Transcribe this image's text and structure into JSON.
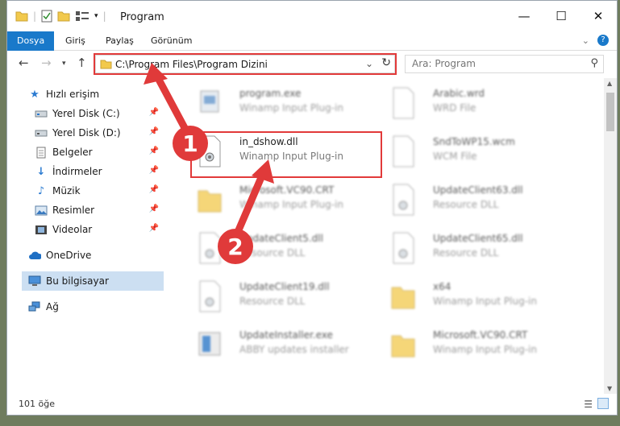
{
  "window": {
    "title": "Program"
  },
  "ribbon": {
    "tabs": [
      {
        "label": "Dosya",
        "active": true
      },
      {
        "label": "Giriş"
      },
      {
        "label": "Paylaş"
      },
      {
        "label": "Görünüm"
      }
    ]
  },
  "address": {
    "path": "C:\\Program Files\\Program Dizini"
  },
  "search": {
    "placeholder": "Ara: Program"
  },
  "sidebar": {
    "items": [
      {
        "label": "Hızlı erişim",
        "icon": "star-icon"
      },
      {
        "label": "Yerel Disk (C:)",
        "icon": "drive-icon"
      },
      {
        "label": "Yerel Disk (D:)",
        "icon": "drive-icon"
      },
      {
        "label": "Belgeler",
        "icon": "document-icon"
      },
      {
        "label": "İndirmeler",
        "icon": "download-icon"
      },
      {
        "label": "Müzik",
        "icon": "music-icon"
      },
      {
        "label": "Resimler",
        "icon": "pictures-icon"
      },
      {
        "label": "Videolar",
        "icon": "video-icon"
      },
      {
        "label": "OneDrive",
        "icon": "cloud-icon"
      },
      {
        "label": "Bu bilgisayar",
        "icon": "computer-icon"
      },
      {
        "label": "Ağ",
        "icon": "network-icon"
      }
    ]
  },
  "files": [
    {
      "name": "program.exe",
      "desc": "Winamp Input Plug-in"
    },
    {
      "name": "Arabic.wrd",
      "desc": "WRD File"
    },
    {
      "name": "in_dshow.dll",
      "desc": "Winamp Input Plug-in"
    },
    {
      "name": "SndToWP15.wcm",
      "desc": "WCM File"
    },
    {
      "name": "Microsoft.VC90.CRT",
      "desc": "Winamp Input Plug-in"
    },
    {
      "name": "UpdateClient63.dll",
      "desc": "Resource DLL"
    },
    {
      "name": "UpdateClient5.dll",
      "desc": "Resource DLL"
    },
    {
      "name": "UpdateClient65.dll",
      "desc": "Resource DLL"
    },
    {
      "name": "UpdateClient19.dll",
      "desc": "Resource DLL"
    },
    {
      "name": "x64",
      "desc": "Winamp Input Plug-in"
    },
    {
      "name": "UpdateInstaller.exe",
      "desc": "ABBY updates installer"
    },
    {
      "name": "Microsoft.VC90.CRT",
      "desc": "Winamp Input Plug-in"
    }
  ],
  "status": {
    "count": "101 öğe"
  },
  "badges": {
    "one": "1",
    "two": "2"
  },
  "colors": {
    "accent": "#1979ca",
    "highlight": "#e23a3a"
  }
}
